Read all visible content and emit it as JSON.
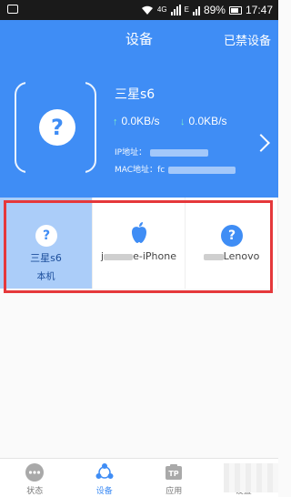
{
  "status_bar": {
    "network": "4G",
    "battery": "89%",
    "time": "17:47"
  },
  "header": {
    "title": "设备",
    "blocked_label": "已禁设备"
  },
  "current_device": {
    "name": "三星s6",
    "upload_speed": "0.0KB/s",
    "download_speed": "0.0KB/s",
    "ip_label": "IP地址：",
    "mac_label": "MAC地址：",
    "mac_prefix": "fc"
  },
  "devices": [
    {
      "name": "三星s6",
      "sub": "本机",
      "icon": "question-icon"
    },
    {
      "name_prefix": "j",
      "name_suffix": "e-iPhone",
      "icon": "apple-icon"
    },
    {
      "name_suffix": "Lenovo",
      "icon": "question-icon"
    }
  ],
  "tabs": [
    {
      "label": "状态",
      "icon": "status-dots-icon"
    },
    {
      "label": "设备",
      "icon": "device-share-icon"
    },
    {
      "label": "应用",
      "icon": "app-tp-icon"
    },
    {
      "label": "设置",
      "icon": "settings-icon"
    }
  ],
  "colors": {
    "primary": "#3f8df5",
    "selected_card": "#abcdf9",
    "highlight_border": "#e5383b"
  }
}
